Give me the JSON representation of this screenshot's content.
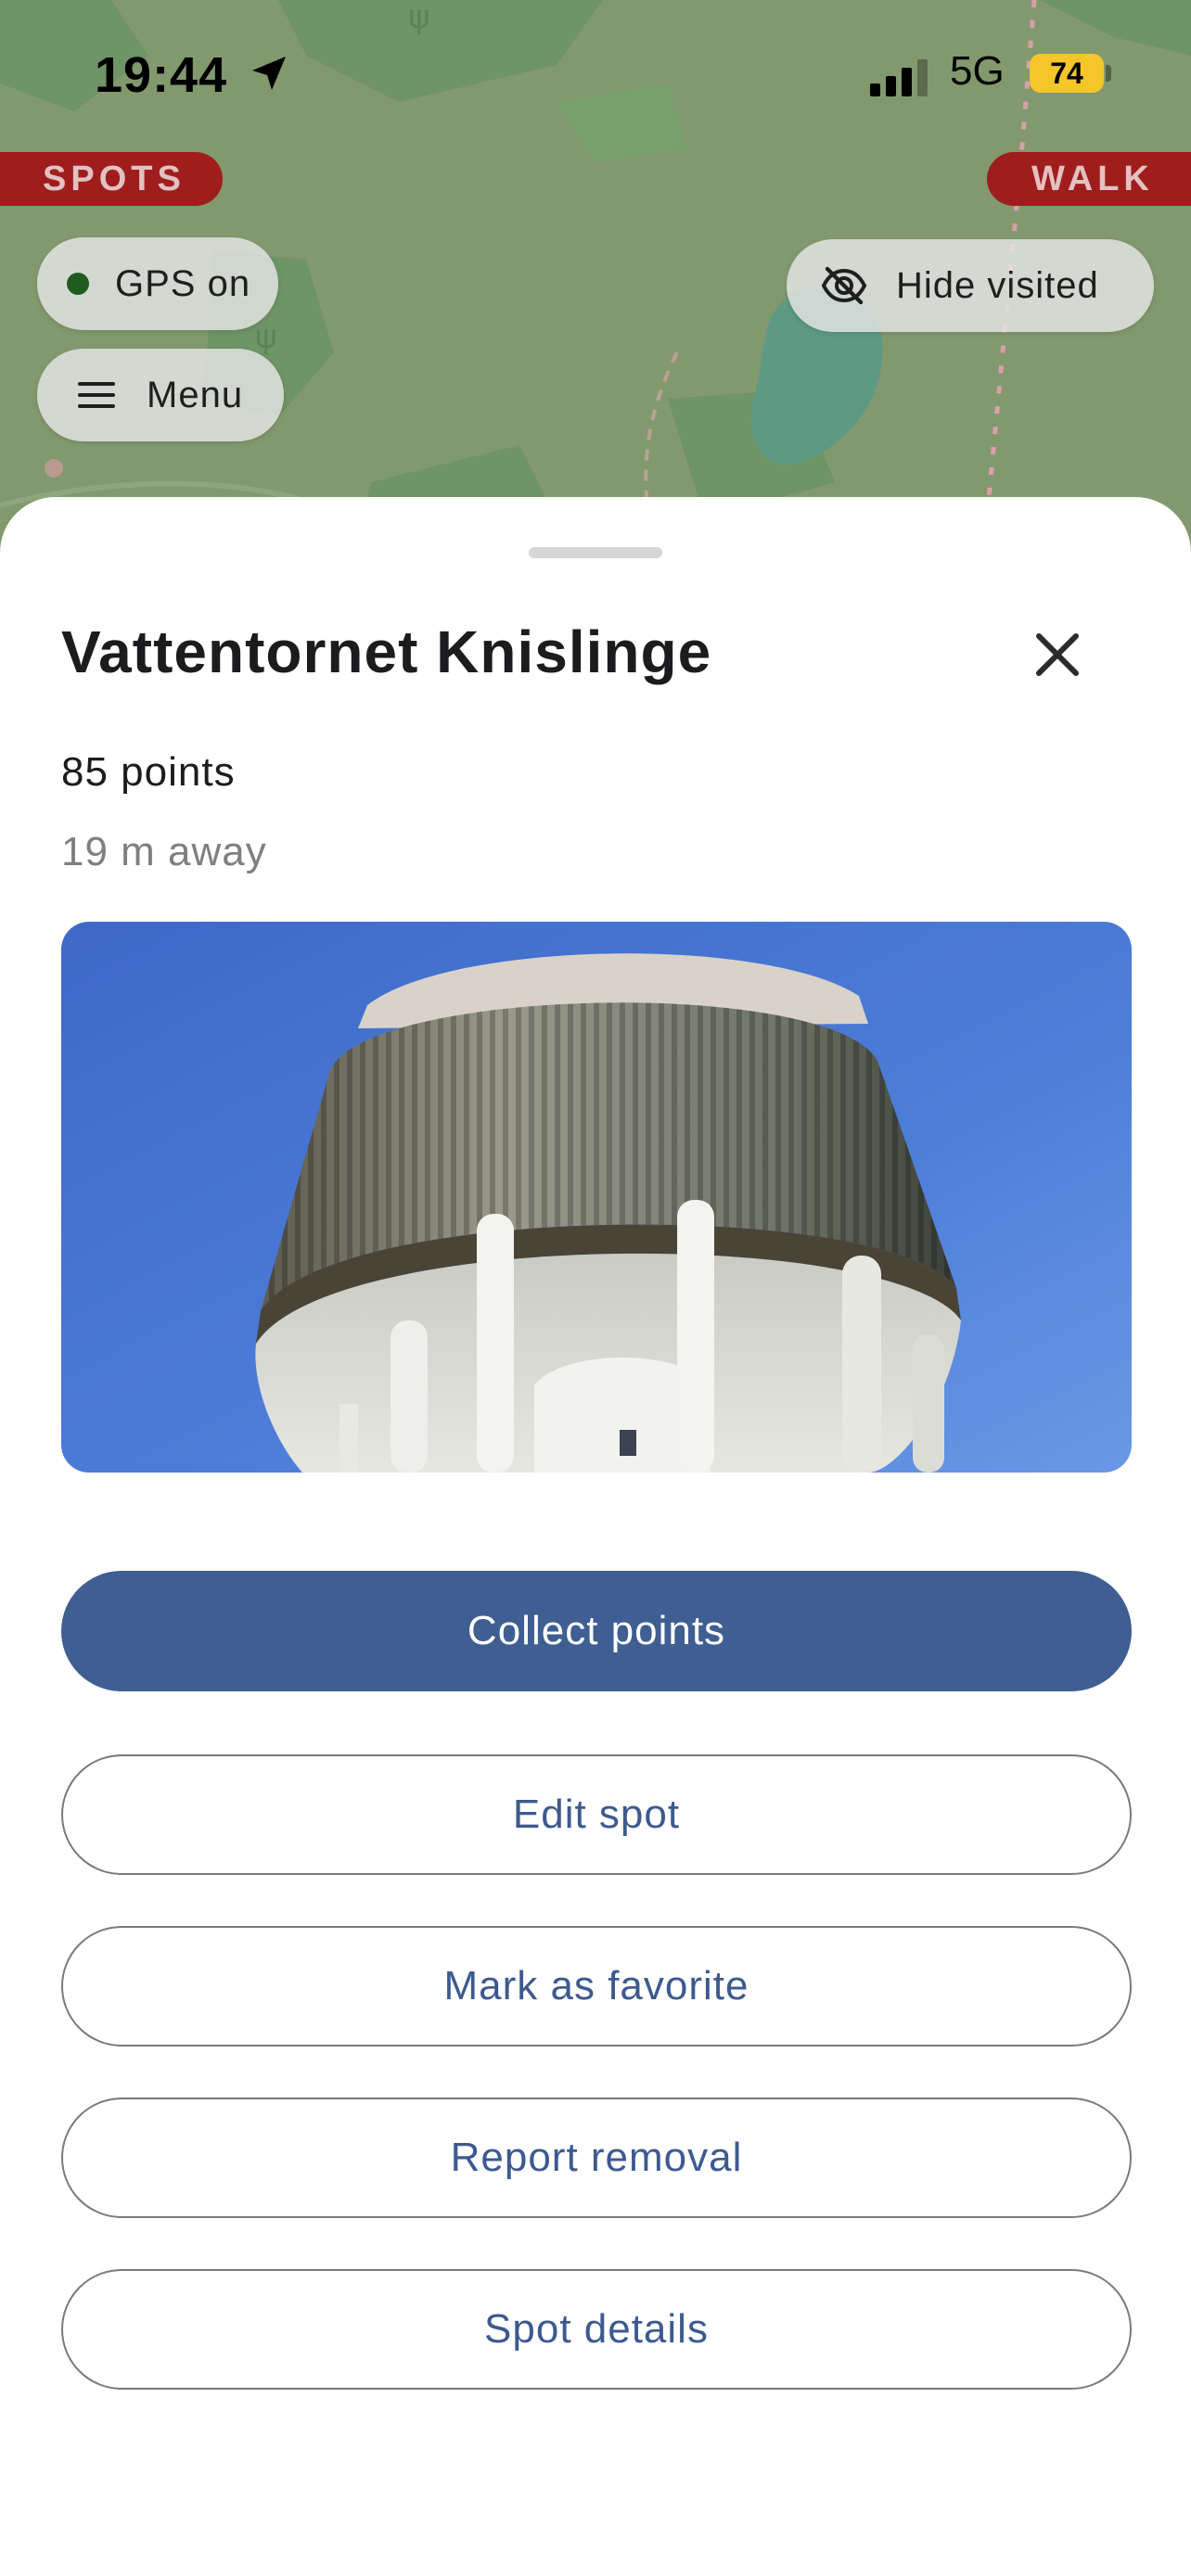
{
  "status_bar": {
    "time": "19:44",
    "network": "5G",
    "battery": "74"
  },
  "map": {
    "spots_tag": "SPOTS",
    "walk_tag": "WALK",
    "gps_label": "GPS on",
    "menu_label": "Menu",
    "hide_visited_label": "Hide visited"
  },
  "sheet": {
    "title": "Vattentornet Knislinge",
    "points": "85 points",
    "distance": "19 m away",
    "buttons": {
      "collect": "Collect points",
      "edit": "Edit spot",
      "favorite": "Mark as favorite",
      "report": "Report removal",
      "details": "Spot details"
    }
  },
  "colors": {
    "accent": "#3f5e92",
    "tag_red": "#9f1d1d",
    "map_green": "#82996e",
    "battery": "#f4c62a"
  },
  "icons": [
    "location-arrow-icon",
    "signal-icon",
    "eye-off-icon",
    "hamburger-icon",
    "close-icon"
  ]
}
